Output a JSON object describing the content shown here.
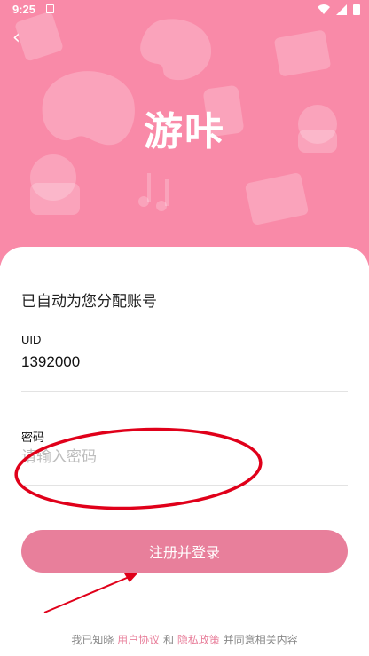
{
  "status_bar": {
    "time": "9:25",
    "icons": [
      "notification-a-icon",
      "wifi-icon",
      "signal-icon",
      "battery-icon"
    ]
  },
  "header": {
    "back_icon": "chevron-left-icon",
    "logo_text": "游咔",
    "background_color": "#f98aa8"
  },
  "form": {
    "title": "已自动为您分配账号",
    "uid_label": "UID",
    "uid_value": "1392000",
    "password_label": "密码",
    "password_placeholder": "请输入密码",
    "submit_label": "注册并登录",
    "accent_color": "#e87f9b"
  },
  "agreement": {
    "prefix": "我已知晓 ",
    "user_agreement": "用户协议",
    "and": " 和 ",
    "privacy_policy": "隐私政策",
    "suffix": " 并同意相关内容"
  },
  "annotations": {
    "ellipse_color": "#e0001a",
    "arrow_color": "#e0001a"
  }
}
